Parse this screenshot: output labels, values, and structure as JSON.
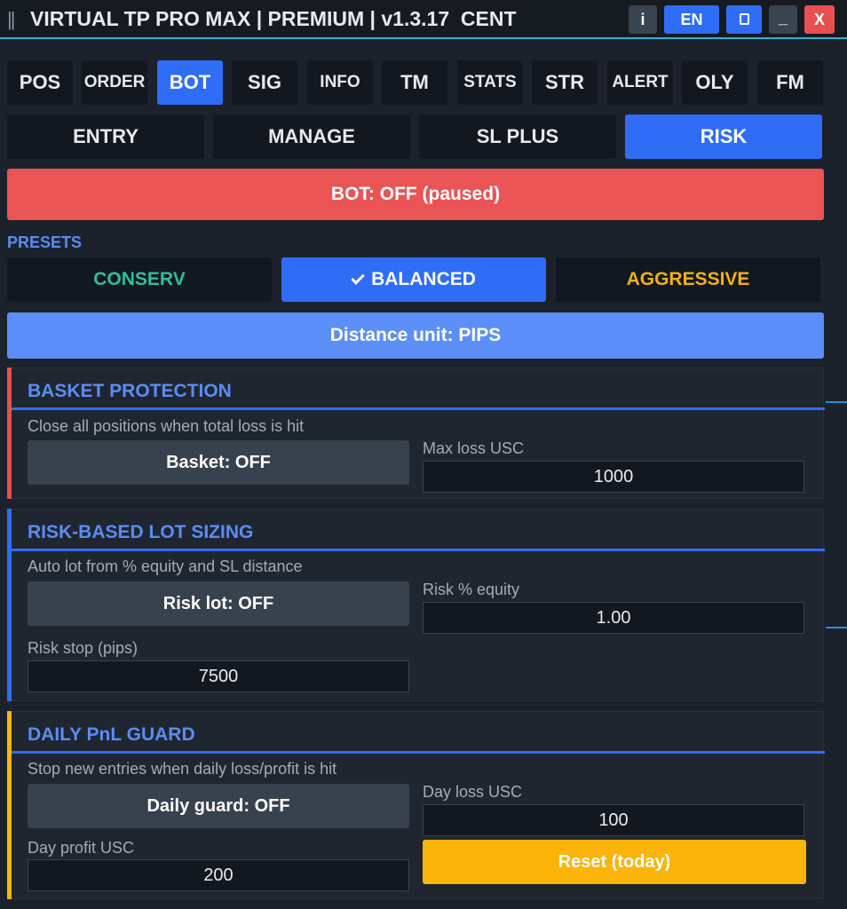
{
  "titlebar": {
    "grip": "||",
    "title": "VIRTUAL TP PRO MAX | PREMIUM | v1.3.17  CENT",
    "info_label": "i",
    "lang_label": "EN",
    "min_label": "_",
    "close_label": "X"
  },
  "tabs": [
    {
      "label": "POS"
    },
    {
      "label": "ORDER"
    },
    {
      "label": "BOT"
    },
    {
      "label": "SIG"
    },
    {
      "label": "INFO"
    },
    {
      "label": "TM"
    },
    {
      "label": "STATS"
    },
    {
      "label": "STR"
    },
    {
      "label": "ALERT"
    },
    {
      "label": "OLY"
    },
    {
      "label": "FM"
    }
  ],
  "active_tab": "BOT",
  "subtabs": [
    {
      "label": "ENTRY"
    },
    {
      "label": "MANAGE"
    },
    {
      "label": "SL PLUS"
    },
    {
      "label": "RISK"
    }
  ],
  "active_subtab": "RISK",
  "bot_status": "BOT: OFF (paused)",
  "presets": {
    "label": "PRESETS",
    "conserv": "CONSERV",
    "balanced": "BALANCED",
    "aggressive": "AGGRESSIVE",
    "selected": "BALANCED"
  },
  "distance_unit": "Distance unit: PIPS",
  "basket": {
    "title": "BASKET PROTECTION",
    "desc": "Close all positions when total loss is hit",
    "toggle": "Basket: OFF",
    "max_loss_label": "Max loss USC",
    "max_loss_value": "1000"
  },
  "risk_lot": {
    "title": "RISK-BASED LOT SIZING",
    "desc": "Auto lot from % equity and SL distance",
    "toggle": "Risk lot: OFF",
    "risk_pct_label": "Risk % equity",
    "risk_pct_value": "1.00",
    "risk_stop_label": "Risk stop (pips)",
    "risk_stop_value": "7500"
  },
  "daily": {
    "title": "DAILY PnL GUARD",
    "desc": "Stop new entries when daily loss/profit is hit",
    "toggle": "Daily guard: OFF",
    "day_loss_label": "Day loss USC",
    "day_loss_value": "100",
    "day_profit_label": "Day profit USC",
    "day_profit_value": "200",
    "reset_label": "Reset (today)"
  },
  "colors": {
    "accent_blue": "#2f6df6",
    "bot_off_red": "#ea5455",
    "basket_accent": "#e8504f",
    "risk_accent": "#2f6df6",
    "daily_accent": "#fbb40a",
    "conserv_green": "#2fbf9a",
    "aggressive_orange": "#f1b114"
  }
}
